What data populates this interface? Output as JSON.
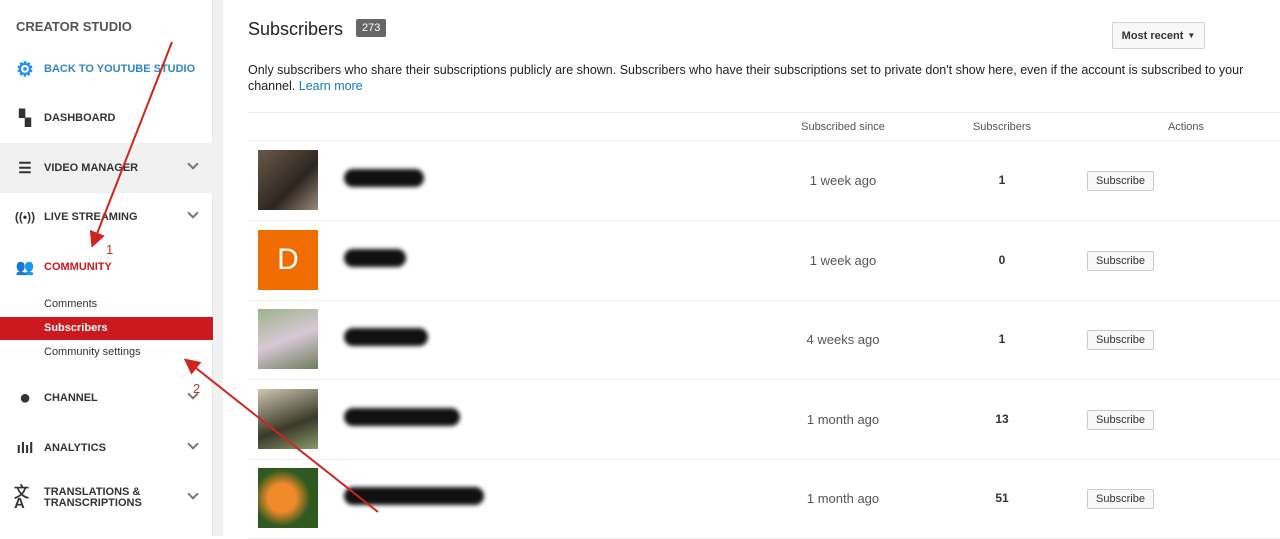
{
  "sidebar": {
    "title": "CREATOR STUDIO",
    "items": [
      {
        "label": "BACK TO YOUTUBE STUDIO",
        "icon": "gear-icon"
      },
      {
        "label": "DASHBOARD",
        "icon": "dashboard-icon"
      },
      {
        "label": "VIDEO MANAGER",
        "icon": "video-manager-icon"
      },
      {
        "label": "LIVE STREAMING",
        "icon": "live-icon"
      },
      {
        "label": "COMMUNITY",
        "icon": "people-icon"
      },
      {
        "label": "CHANNEL",
        "icon": "account-icon"
      },
      {
        "label": "ANALYTICS",
        "icon": "bar-chart-icon"
      },
      {
        "label": "TRANSLATIONS &",
        "label2": "TRANSCRIPTIONS",
        "icon": "translate-icon"
      }
    ],
    "community_sub": [
      "Comments",
      "Subscribers",
      "Community settings"
    ]
  },
  "header": {
    "title": "Subscribers",
    "count": "273",
    "sort": "Most recent"
  },
  "description": {
    "text": "Only subscribers who share their subscriptions publicly are shown. Subscribers who have their subscriptions set to private don't show here, even if the account is subscribed to your channel.",
    "link": "Learn more"
  },
  "table": {
    "columns": [
      "Subscribed since",
      "Subscribers",
      "Actions"
    ],
    "rows": [
      {
        "since": "1 week ago",
        "subscribers": "1",
        "action": "Subscribe"
      },
      {
        "since": "1 week ago",
        "subscribers": "0",
        "action": "Subscribe",
        "avatar_letter": "D"
      },
      {
        "since": "4 weeks ago",
        "subscribers": "1",
        "action": "Subscribe"
      },
      {
        "since": "1 month ago",
        "subscribers": "13",
        "action": "Subscribe"
      },
      {
        "since": "1 month ago",
        "subscribers": "51",
        "action": "Subscribe"
      }
    ]
  },
  "annotations": [
    "1",
    "2"
  ],
  "colors": {
    "accent": "#cc181e",
    "link": "#167ac6",
    "studio_blue": "#2793e6"
  }
}
